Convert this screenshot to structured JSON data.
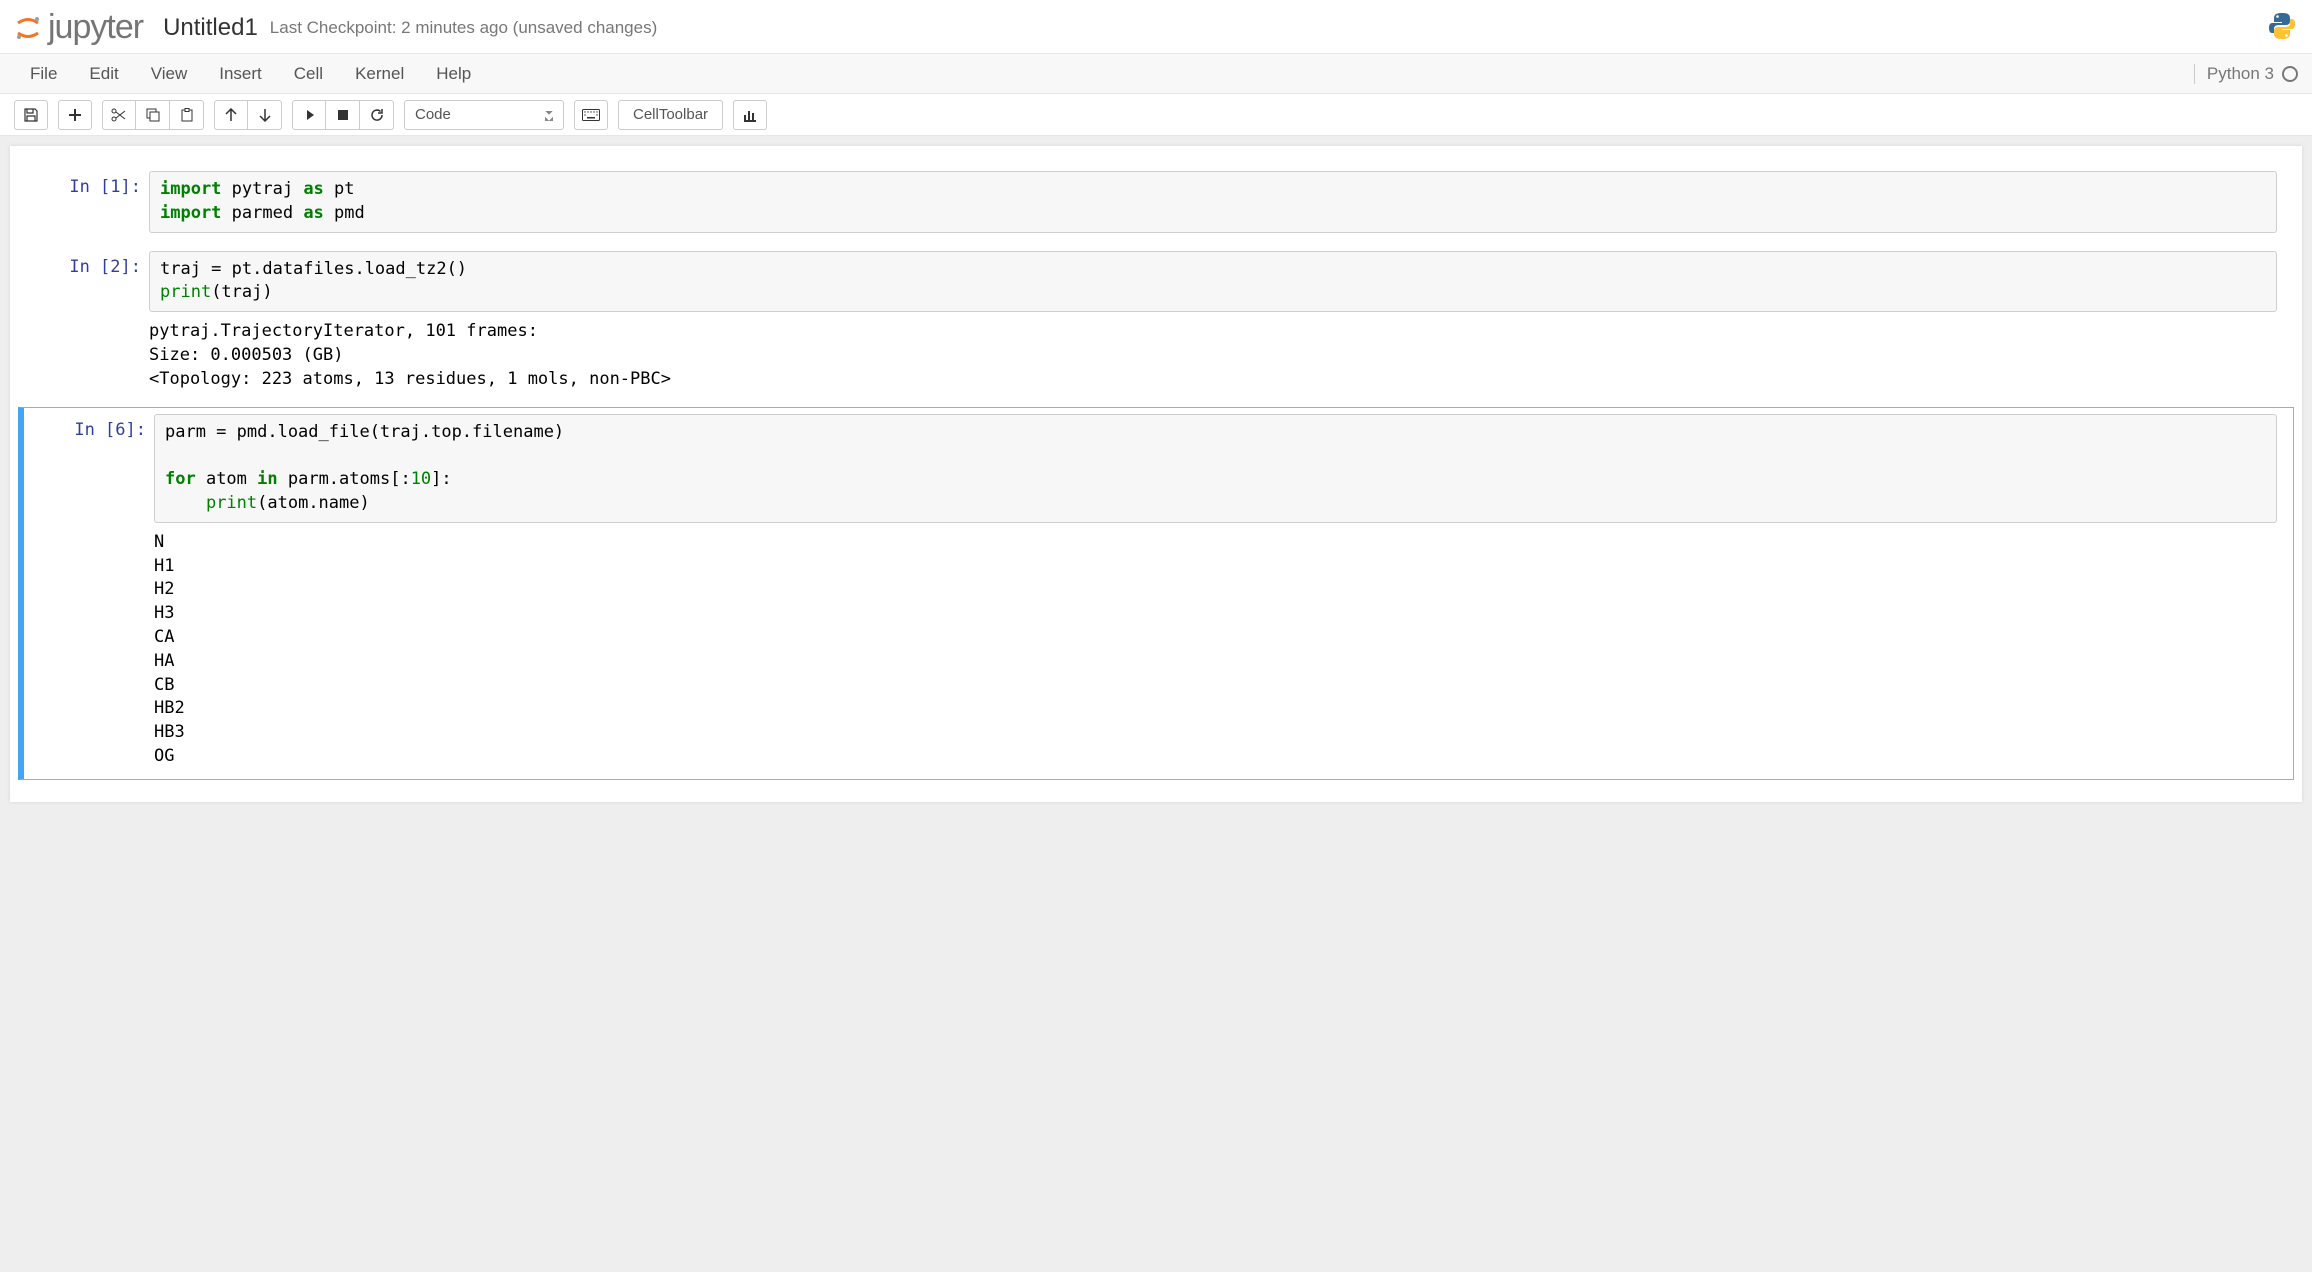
{
  "header": {
    "jupyter_word": "jupyter",
    "title": "Untitled1",
    "checkpoint": "Last Checkpoint: 2 minutes ago (unsaved changes)"
  },
  "menu": {
    "items": [
      "File",
      "Edit",
      "View",
      "Insert",
      "Cell",
      "Kernel",
      "Help"
    ],
    "kernel_label": "Python 3"
  },
  "toolbar": {
    "cell_type": "Code",
    "cell_toolbar": "CellToolbar"
  },
  "cells": [
    {
      "selected": false,
      "prompt_num": 1,
      "code_tokens": [
        {
          "t": "import",
          "c": "kw"
        },
        {
          "t": " pytraj "
        },
        {
          "t": "as",
          "c": "kw"
        },
        {
          "t": " pt\n"
        },
        {
          "t": "import",
          "c": "kw"
        },
        {
          "t": " parmed "
        },
        {
          "t": "as",
          "c": "kw"
        },
        {
          "t": " pmd"
        }
      ],
      "output": null
    },
    {
      "selected": false,
      "prompt_num": 2,
      "code_tokens": [
        {
          "t": "traj = pt.datafiles.load_tz2()\n"
        },
        {
          "t": "print",
          "c": "par"
        },
        {
          "t": "(traj)"
        }
      ],
      "output": "pytraj.TrajectoryIterator, 101 frames: \nSize: 0.000503 (GB)\n<Topology: 223 atoms, 13 residues, 1 mols, non-PBC>\n"
    },
    {
      "selected": true,
      "prompt_num": 6,
      "code_tokens": [
        {
          "t": "parm = pmd.load_file(traj.top.filename)\n\n"
        },
        {
          "t": "for",
          "c": "kw"
        },
        {
          "t": " atom "
        },
        {
          "t": "in",
          "c": "kw"
        },
        {
          "t": " parm.atoms[:"
        },
        {
          "t": "10",
          "c": "s-num"
        },
        {
          "t": "]:\n"
        },
        {
          "t": "    "
        },
        {
          "t": "print",
          "c": "par"
        },
        {
          "t": "(atom.name)"
        }
      ],
      "output": "N\nH1\nH2\nH3\nCA\nHA\nCB\nHB2\nHB3\nOG"
    }
  ]
}
